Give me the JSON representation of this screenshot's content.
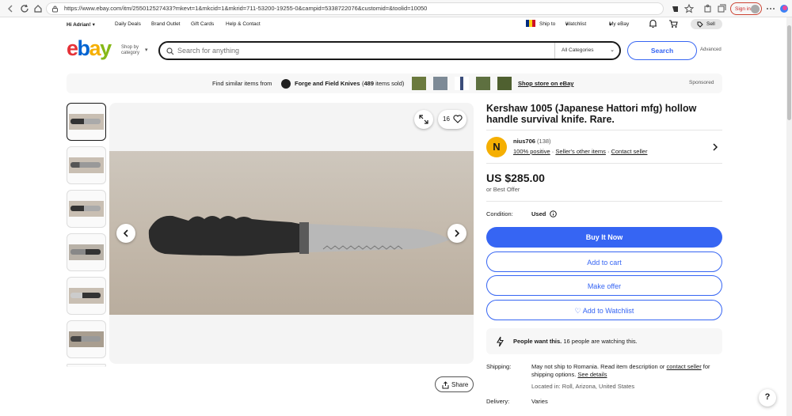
{
  "browser": {
    "url": "https://www.ebay.com/itm/255012527433?mkevt=1&mkcid=1&mkrid=711-53200-19255-0&campid=5338722076&customid=&toolid=10050",
    "signin_label": "Sign in"
  },
  "topnav": {
    "greeting": "Hi Adrian!",
    "daily_deals": "Daily Deals",
    "brand_outlet": "Brand Outlet",
    "gift_cards": "Gift Cards",
    "help_contact": "Help & Contact",
    "ship_to": "Ship to",
    "watchlist": "Watchlist",
    "my_ebay": "My eBay",
    "sell": "Sell"
  },
  "header": {
    "logo": {
      "e": "e",
      "b": "b",
      "a": "a",
      "y": "y"
    },
    "shop_by_line1": "Shop by",
    "shop_by_line2": "category",
    "search_placeholder": "Search for anything",
    "category": "All Categories",
    "search_button": "Search",
    "advanced": "Advanced"
  },
  "banner": {
    "find_similar": "Find similar items from",
    "store_name": "Forge and Field Knives",
    "items_sold_open": "(",
    "items_sold_count": "489",
    "items_sold_rest": "items sold)",
    "shop_store": "Shop store on eBay",
    "sponsored": "Sponsored"
  },
  "gallery": {
    "watch_count": "16",
    "share_label": "Share"
  },
  "listing": {
    "title": "Kershaw 1005 (Japanese Hattori mfg) hollow handle survival knife. Rare.",
    "seller_initial": "N",
    "seller_name": "nius706",
    "seller_feedback": "(138)",
    "positive": "100% positive",
    "sellers_other_items": "Seller's other items",
    "contact_seller": "Contact seller",
    "price": "US $285.00",
    "best_offer": "or Best Offer",
    "condition_label": "Condition:",
    "condition_value": "Used",
    "buy_now": "Buy It Now",
    "add_to_cart": "Add to cart",
    "make_offer": "Make offer",
    "add_to_watchlist": "Add to Watchlist",
    "people_want": "People want this.",
    "watching": "16 people are watching this.",
    "shipping_label": "Shipping:",
    "shipping_text": "May not ship to Romania. Read item description or",
    "shipping_contact": "contact seller",
    "shipping_for": "for",
    "shipping_options": "shipping options.",
    "see_details": "See details",
    "located": "Located in: Roll, Arizona, United States",
    "delivery_label": "Delivery:",
    "delivery_value": "Varies"
  },
  "colors": {
    "primary": "#3665f3",
    "ebay_red": "#e53238",
    "ebay_blue": "#0064d2",
    "ebay_yellow": "#f5af02",
    "ebay_green": "#86b817"
  }
}
